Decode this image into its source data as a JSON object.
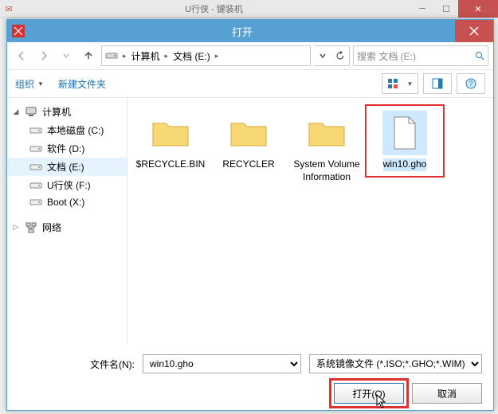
{
  "bg": {
    "title": "U行侠 - 键装机"
  },
  "window": {
    "title": "打开"
  },
  "nav": {
    "breadcrumb": [
      {
        "label": "计算机"
      },
      {
        "label": "文档 (E:)"
      }
    ],
    "search_placeholder": "搜索 文档 (E:)"
  },
  "toolbar": {
    "organize": "组织",
    "new_folder": "新建文件夹"
  },
  "tree": {
    "root_computer": "计算机",
    "items": [
      {
        "label": "本地磁盘 (C:)"
      },
      {
        "label": "软件 (D:)"
      },
      {
        "label": "文档 (E:)",
        "selected": true
      },
      {
        "label": "U行侠 (F:)"
      },
      {
        "label": "Boot (X:)"
      }
    ],
    "network": "网络"
  },
  "files": [
    {
      "name": "$RECYCLE.BIN",
      "type": "folder"
    },
    {
      "name": "RECYCLER",
      "type": "folder"
    },
    {
      "name": "System Volume Information",
      "type": "folder"
    },
    {
      "name": "win10.gho",
      "type": "file",
      "selected": true
    }
  ],
  "footer": {
    "filename_label": "文件名(N):",
    "filename_value": "win10.gho",
    "filter_value": "系统镜像文件 (*.ISO;*.GHO;*.WIM)",
    "open": "打开(O)",
    "cancel": "取消"
  }
}
